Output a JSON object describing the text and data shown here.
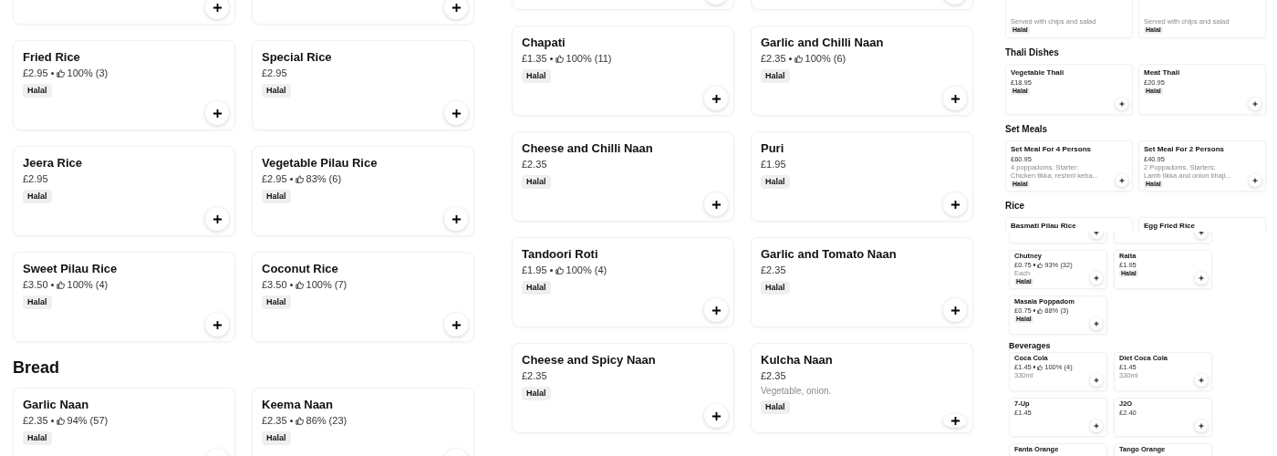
{
  "panels": [
    {
      "blocks": [
        {
          "kind": "cards",
          "cards": [
            {
              "add_button": true
            },
            {
              "add_button": true
            }
          ]
        },
        {
          "kind": "cards",
          "cards": [
            {
              "name": "Fried Rice",
              "price": "£2.95",
              "rating": "100% (3)",
              "tag": "Halal"
            },
            {
              "name": "Special Rice",
              "price": "£2.95",
              "tag": "Halal"
            }
          ]
        },
        {
          "kind": "cards",
          "cards": [
            {
              "name": "Jeera Rice",
              "price": "£2.95",
              "tag": "Halal"
            },
            {
              "name": "Vegetable Pilau Rice",
              "price": "£2.95",
              "rating": "83% (6)",
              "tag": "Halal"
            }
          ]
        },
        {
          "kind": "cards",
          "cards": [
            {
              "name": "Sweet Pilau Rice",
              "price": "£3.50",
              "rating": "100% (4)",
              "tag": "Halal"
            },
            {
              "name": "Coconut Rice",
              "price": "£3.50",
              "rating": "100% (7)",
              "tag": "Halal"
            }
          ]
        },
        {
          "kind": "heading",
          "text": "Bread"
        },
        {
          "kind": "cards",
          "cards": [
            {
              "name": "Garlic Naan",
              "price": "£2.35",
              "rating": "94% (57)",
              "tag": "Halal"
            },
            {
              "name": "Keema Naan",
              "price": "£2.35",
              "rating": "86% (23)",
              "tag": "Halal"
            }
          ]
        }
      ]
    },
    {
      "blocks": [
        {
          "kind": "cards",
          "cards": [
            {
              "add_button": true
            },
            {
              "add_button": true
            }
          ]
        },
        {
          "kind": "cards",
          "cards": [
            {
              "name": "Chapati",
              "price": "£1.35",
              "rating": "100% (11)",
              "tag": "Halal"
            },
            {
              "name": "Garlic and Chilli Naan",
              "price": "£2.35",
              "rating": "100% (6)",
              "tag": "Halal"
            }
          ]
        },
        {
          "kind": "cards",
          "cards": [
            {
              "name": "Cheese and Chilli Naan",
              "price": "£2.35",
              "tag": "Halal"
            },
            {
              "name": "Puri",
              "price": "£1.95",
              "tag": "Halal"
            }
          ]
        },
        {
          "kind": "cards",
          "cards": [
            {
              "name": "Tandoori Roti",
              "price": "£1.95",
              "rating": "100% (4)",
              "tag": "Halal"
            },
            {
              "name": "Garlic and Tomato Naan",
              "price": "£2.35",
              "tag": "Halal"
            }
          ]
        },
        {
          "kind": "cards",
          "cards": [
            {
              "name": "Cheese and Spicy Naan",
              "price": "£2.35",
              "tag": "Halal"
            },
            {
              "name": "Kulcha Naan",
              "price": "£2.35",
              "description": [
                "Vegetable, onion."
              ],
              "tag": "Halal"
            }
          ]
        }
      ]
    },
    {
      "blocks": [
        {
          "kind": "cards",
          "cards": [
            {
              "description": [
                "Served with chips and salad"
              ],
              "tag": "Halal"
            },
            {
              "description": [
                "Served with chips and salad"
              ],
              "tag": "Halal"
            }
          ]
        },
        {
          "kind": "heading",
          "text": "Thali Dishes"
        },
        {
          "kind": "cards",
          "cards": [
            {
              "name": "Vegetable Thali",
              "price": "£18.95",
              "tag": "Halal"
            },
            {
              "name": "Meat Thali",
              "price": "£20.95",
              "tag": "Halal"
            }
          ]
        },
        {
          "kind": "heading",
          "text": "Set Meals"
        },
        {
          "kind": "cards",
          "cards": [
            {
              "name": "Set Meal For 4 Persons",
              "price": "£60.95",
              "description": [
                "4 poppadoms. Starter:",
                "Chicken tikka, reshmi keba..."
              ],
              "tag": "Halal"
            },
            {
              "name": "Set Meal For 2 Persons",
              "price": "£40.95",
              "description": [
                "2 Poppadoms. Starters:",
                "Lamb tikka and onion bhaji..."
              ],
              "tag": "Halal"
            }
          ]
        },
        {
          "kind": "heading",
          "text": "Rice"
        },
        {
          "kind": "cards",
          "cards": [
            {
              "name": "Basmati Pilau Rice"
            },
            {
              "name": "Egg Fried Rice"
            }
          ]
        }
      ]
    },
    {
      "blocks": [
        {
          "kind": "cards",
          "cards": [
            {
              "add_button": true
            },
            {
              "add_button": true
            }
          ]
        },
        {
          "kind": "cards",
          "cards": [
            {
              "name": "Chutney",
              "price": "£0.75",
              "rating": "93% (32)",
              "description": [
                "Each"
              ],
              "tag": "Halal"
            },
            {
              "name": "Raita",
              "price": "£1.95",
              "tag": "Halal"
            }
          ]
        },
        {
          "kind": "cards",
          "cards": [
            {
              "name": "Masala Poppadom",
              "price": "£0.75",
              "rating": "88% (3)",
              "tag": "Halal"
            }
          ]
        },
        {
          "kind": "heading",
          "text": "Beverages"
        },
        {
          "kind": "cards",
          "cards": [
            {
              "name": "Coca Cola",
              "price": "£1.45",
              "rating": "100% (4)",
              "description": [
                "330ml"
              ]
            },
            {
              "name": "Diet Coca Cola",
              "price": "£1.45",
              "description": [
                "330ml"
              ]
            }
          ]
        },
        {
          "kind": "cards",
          "cards": [
            {
              "name": "7-Up",
              "price": "£1.45"
            },
            {
              "name": "J2O",
              "price": "£2.40"
            }
          ]
        },
        {
          "kind": "cards",
          "cards": [
            {
              "name": "Fanta Orange"
            },
            {
              "name": "Tango Orange"
            }
          ]
        }
      ]
    }
  ]
}
